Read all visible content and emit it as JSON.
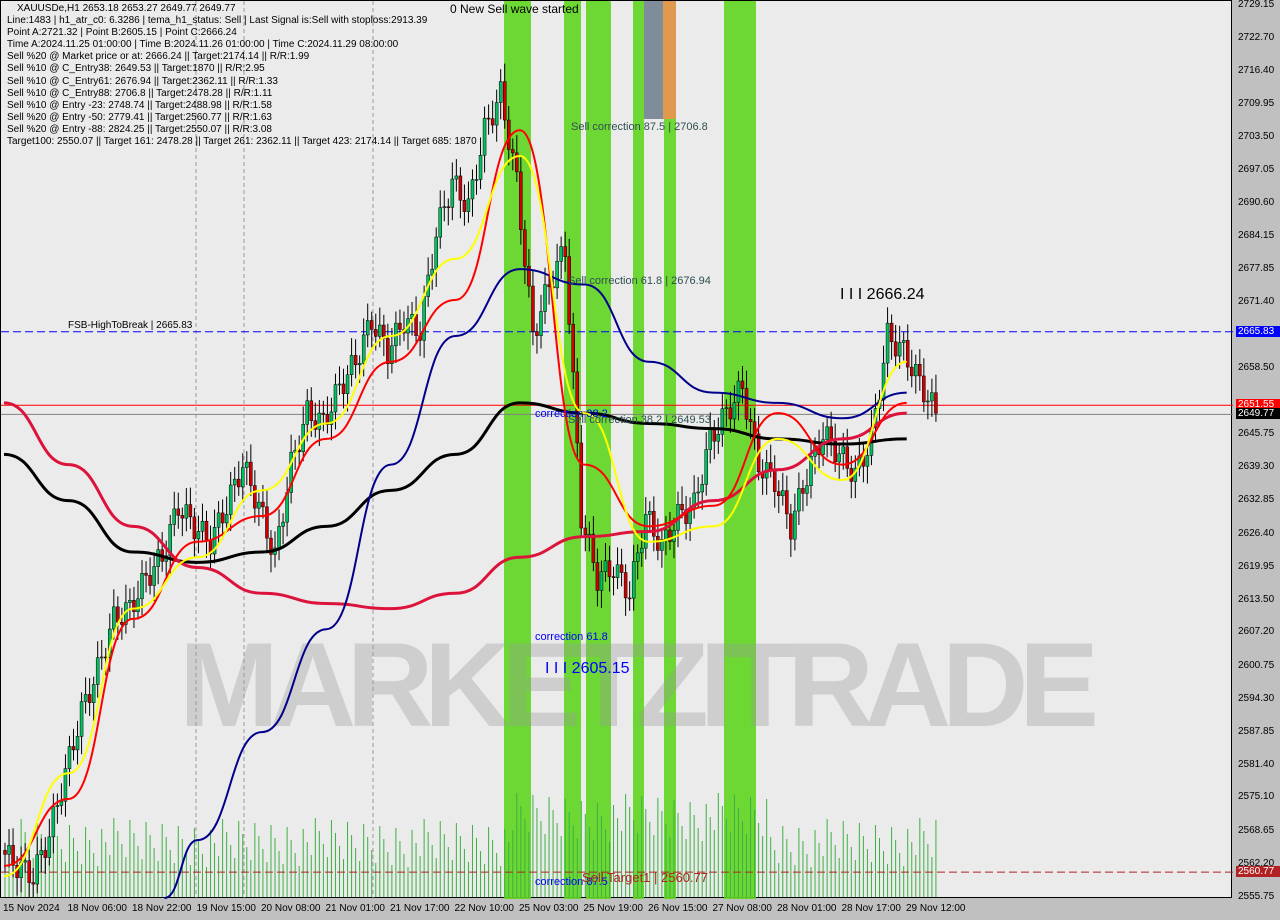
{
  "header": {
    "symbol_line": "XAUUSDe,H1  2653.18 2653.27 2649.77 2649.77",
    "lines": [
      "Line:1483 | h1_atr_c0: 6.3286 | tema_h1_status: Sell | Last Signal is:Sell with stoploss:2913.39",
      "Point A:2721.32 | Point B:2605.15 | Point C:2666.24",
      "Time A:2024.11.25 01:00:00 | Time B:2024.11.26 01:00:00 | Time C:2024.11.29 08:00:00",
      "Sell %20 @ Market price or at: 2666.24 || Target:2174.14 || R/R:1.99",
      "Sell %10 @ C_Entry38: 2649.53 || Target:1870 || R/R:2.95",
      "Sell %10 @ C_Entry61: 2676.94 || Target:2362.11 || R/R:1.33",
      "Sell %10 @ C_Entry88: 2706.8 || Target:2478.28 || R/R:1.11",
      "Sell %10 @ Entry -23: 2748.74 || Target:2488.98 || R/R:1.58",
      "Sell %20 @ Entry -50: 2779.41 || Target:2560.77 || R/R:1.63",
      "Sell %20 @ Entry -88: 2824.25 || Target:2550.07 || R/R:3.08",
      "Target100: 2550.07 || Target 161: 2478.28 || Target 261: 2362.11 || Target 423: 2174.14 || Target 685: 1870"
    ]
  },
  "chart_data": {
    "type": "candlestick",
    "symbol": "XAUUSDe",
    "timeframe": "H1",
    "ylim": [
      2555.75,
      2729.15
    ],
    "y_ticks": [
      "2729.15",
      "2722.70",
      "2716.40",
      "2709.95",
      "2703.50",
      "2697.05",
      "2690.60",
      "2684.15",
      "2677.85",
      "2671.40",
      "2664.95",
      "2658.50",
      "2645.75",
      "2639.30",
      "2632.85",
      "2626.40",
      "2619.95",
      "2613.50",
      "2607.20",
      "2600.75",
      "2594.30",
      "2587.85",
      "2581.40",
      "2575.10",
      "2568.65",
      "2562.20",
      "2555.75"
    ],
    "x_ticks": [
      "15 Nov 2024",
      "18 Nov 06:00",
      "18 Nov 22:00",
      "19 Nov 15:00",
      "20 Nov 08:00",
      "21 Nov 01:00",
      "21 Nov 17:00",
      "22 Nov 10:00",
      "25 Nov 03:00",
      "25 Nov 19:00",
      "26 Nov 15:00",
      "27 Nov 08:00",
      "28 Nov 01:00",
      "28 Nov 17:00",
      "29 Nov 12:00"
    ],
    "closes_every_4_bars": [
      2565,
      2562,
      2560,
      2568,
      2580,
      2592,
      2600,
      2610,
      2612,
      2618,
      2622,
      2632,
      2628,
      2625,
      2632,
      2640,
      2632,
      2622,
      2640,
      2650,
      2648,
      2655,
      2660,
      2668,
      2662,
      2668,
      2666,
      2685,
      2695,
      2690,
      2705,
      2712,
      2695,
      2665,
      2675,
      2682,
      2630,
      2618,
      2620,
      2615,
      2630,
      2624,
      2630,
      2632,
      2645,
      2650,
      2655,
      2640,
      2637,
      2628,
      2638,
      2646,
      2642,
      2638,
      2645,
      2665,
      2662,
      2656,
      2650
    ],
    "series": [
      {
        "color": "#000000",
        "values_every_16_bars": [
          2642,
          2633,
          2623,
          2621,
          2623,
          2628,
          2635,
          2642,
          2652,
          2650,
          2648,
          2647,
          2645,
          2644,
          2645
        ]
      },
      {
        "color": "#dc143c",
        "values_every_16_bars": [
          2652,
          2640,
          2628,
          2620,
          2615,
          2613,
          2612,
          2615,
          2622,
          2626,
          2627,
          2633,
          2639,
          2645,
          2650
        ]
      },
      {
        "color": "#00008b",
        "values_every_16_bars": [
          2515,
          2525,
          2545,
          2567,
          2588,
          2608,
          2640,
          2665,
          2678,
          2675,
          2660,
          2654,
          2652,
          2649,
          2654
        ]
      },
      {
        "color": "#ff0000",
        "values_every_16_bars": [
          2562,
          2575,
          2610,
          2625,
          2630,
          2645,
          2660,
          2672,
          2705,
          2640,
          2628,
          2632,
          2650,
          2640,
          2652
        ]
      },
      {
        "color": "#ffff00",
        "values_every_16_bars": [
          2560,
          2580,
          2612,
          2622,
          2635,
          2648,
          2665,
          2680,
          2700,
          2650,
          2625,
          2628,
          2645,
          2637,
          2660
        ]
      }
    ],
    "hlines": [
      {
        "price": 2665.83,
        "color": "#0000ff",
        "style": "dashed",
        "tag": "2665.83",
        "label": "FSB-HighToBreak | 2665.83"
      },
      {
        "price": 2651.55,
        "color": "#ff0000",
        "style": "solid",
        "tag": "2651.55"
      },
      {
        "price": 2649.77,
        "color": "#808080",
        "style": "solid",
        "tag": "2649.77"
      },
      {
        "price": 2560.77,
        "color": "#b22222",
        "style": "dashed",
        "tag": "2560.77"
      }
    ],
    "annotations": {
      "wave": "0 New Sell wave started",
      "sell_corr_875": "Sell correction 87.5 | 2706.8",
      "sell_corr_618": "Sell correction 61.8 | 2676.94",
      "sell_corr_382": "Sell correction 38.2 | 2649.53",
      "corr_382": "correction 38.2",
      "corr_618": "correction 61.8",
      "corr_875": "correction 87.5",
      "point_c": "I I I 2666.24",
      "point_b": "I I I 2605.15",
      "target1": "Sell Target1 | 2560.77"
    },
    "watermark": "MARKETZITRADE",
    "colors": {
      "bull": "#00c060",
      "bear": "#d00000",
      "band": "#5fd620",
      "background": "#ebebeb"
    }
  }
}
